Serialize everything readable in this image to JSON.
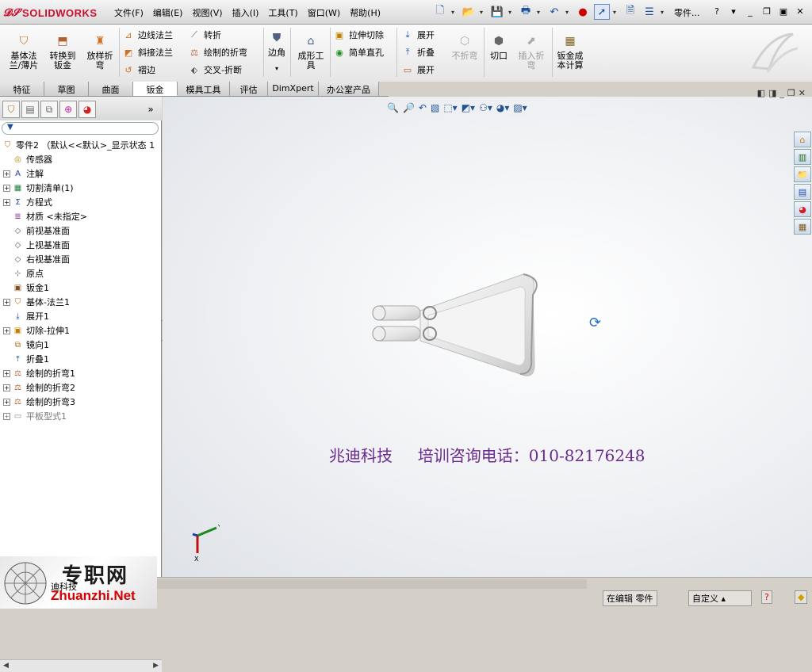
{
  "app": {
    "brand": "SOLIDWORKS",
    "document_label": "零件..."
  },
  "menu": [
    "文件(F)",
    "编辑(E)",
    "视图(V)",
    "插入(I)",
    "工具(T)",
    "窗口(W)",
    "帮助(H)"
  ],
  "command_manager": {
    "large": [
      {
        "id": "base-flange",
        "label": "基体法\n兰/薄片"
      },
      {
        "id": "convert",
        "label": "转换到\n钣金"
      },
      {
        "id": "lofted-bend",
        "label": "放样折\n弯"
      },
      {
        "id": "corner",
        "label": "边角"
      },
      {
        "id": "forming",
        "label": "成形工\n具"
      },
      {
        "id": "no-bends",
        "label": "不折弯",
        "disabled": true
      },
      {
        "id": "rip",
        "label": "切口"
      },
      {
        "id": "insert-bends",
        "label": "插入折\n弯",
        "disabled": true
      },
      {
        "id": "sm-cost",
        "label": "钣金成\n本计算"
      }
    ],
    "small": [
      {
        "id": "edge-flange",
        "label": "边线法兰"
      },
      {
        "id": "miter-flange",
        "label": "斜接法兰"
      },
      {
        "id": "hem",
        "label": "褶边"
      },
      {
        "id": "jog",
        "label": "转折"
      },
      {
        "id": "sketched-bend",
        "label": "绘制的折弯"
      },
      {
        "id": "cross-break",
        "label": "交叉-折断"
      },
      {
        "id": "extruded-cut",
        "label": "拉伸切除"
      },
      {
        "id": "simple-hole",
        "label": "简单直孔"
      },
      {
        "id": "unfold",
        "label": "展开"
      },
      {
        "id": "fold",
        "label": "折叠"
      },
      {
        "id": "flatten",
        "label": "展开"
      }
    ]
  },
  "tabs": [
    {
      "label": "特征",
      "active": false
    },
    {
      "label": "草图",
      "active": false
    },
    {
      "label": "曲面",
      "active": false
    },
    {
      "label": "钣金",
      "active": true
    },
    {
      "label": "模具工具",
      "active": false
    },
    {
      "label": "评估",
      "active": false
    },
    {
      "label": "DimXpert",
      "active": false
    },
    {
      "label": "办公室产品",
      "active": false
    }
  ],
  "tree": [
    {
      "label": "零件2 （默认<<默认>_显示状态 1",
      "expander": "",
      "icon": "part-icon"
    },
    {
      "label": "传感器",
      "expander": "none",
      "icon": "sensor-icon"
    },
    {
      "label": "注解",
      "expander": "+",
      "icon": "annotation-icon"
    },
    {
      "label": "切割清单(1)",
      "expander": "+",
      "icon": "cutlist-icon"
    },
    {
      "label": "方程式",
      "expander": "+",
      "icon": "equation-icon"
    },
    {
      "label": "材质 <未指定>",
      "expander": "none",
      "icon": "material-icon"
    },
    {
      "label": "前视基准面",
      "expander": "none",
      "icon": "plane-icon"
    },
    {
      "label": "上视基准面",
      "expander": "none",
      "icon": "plane-icon"
    },
    {
      "label": "右视基准面",
      "expander": "none",
      "icon": "plane-icon"
    },
    {
      "label": "原点",
      "expander": "none",
      "icon": "origin-icon"
    },
    {
      "label": "钣金1",
      "expander": "none",
      "icon": "sheetmetal-icon"
    },
    {
      "label": "基体-法兰1",
      "expander": "+",
      "icon": "flange-icon"
    },
    {
      "label": "展开1",
      "expander": "none",
      "icon": "unfold-icon"
    },
    {
      "label": "切除-拉伸1",
      "expander": "+",
      "icon": "cut-icon"
    },
    {
      "label": "镜向1",
      "expander": "none",
      "icon": "mirror-icon"
    },
    {
      "label": "折叠1",
      "expander": "none",
      "icon": "fold-icon"
    },
    {
      "label": "绘制的折弯1",
      "expander": "+",
      "icon": "bend-icon"
    },
    {
      "label": "绘制的折弯2",
      "expander": "+",
      "icon": "bend-icon"
    },
    {
      "label": "绘制的折弯3",
      "expander": "+",
      "icon": "bend-icon"
    },
    {
      "label": "平板型式1",
      "expander": "+",
      "icon": "flatpattern-icon",
      "suppressed": true
    }
  ],
  "overlay": {
    "text": "兆迪科技     培训咨询电话：010-82176248",
    "color": "#6b2a8f"
  },
  "status": {
    "mode": "在编辑 零件",
    "units": "自定义"
  },
  "watermark": {
    "big": "专职网",
    "url": "Zhuanzhi.Net",
    "small": "迪科技"
  },
  "colors": {
    "accent": "#1a4f9c",
    "brand": "#c8102e"
  }
}
